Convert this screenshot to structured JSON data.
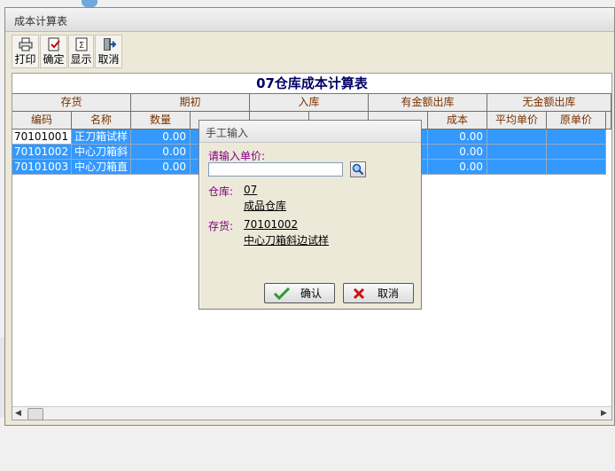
{
  "window": {
    "title": "成本计算表"
  },
  "toolbar": {
    "print": "打印",
    "confirm": "确定",
    "display": "显示",
    "cancel": "取消"
  },
  "report": {
    "title": "07仓库成本计算表",
    "groups": [
      "存货",
      "期初",
      "入库",
      "有金额出库",
      "无金额出库"
    ],
    "columns": {
      "code": "编码",
      "name": "名称",
      "qty": "数量",
      "out_cost": "成本",
      "avg_price": "平均单价",
      "orig_price": "原单价"
    },
    "rows": [
      {
        "code": "70101001",
        "name": "正刀箱试样",
        "qty": "0.00",
        "out_cost": "0.00"
      },
      {
        "code": "70101002",
        "name": "中心刀箱斜",
        "qty": "0.00",
        "out_cost": "0.00"
      },
      {
        "code": "70101003",
        "name": "中心刀箱直",
        "qty": "0.00",
        "out_cost": "0.00"
      }
    ]
  },
  "dialog": {
    "title": "手工输入",
    "prompt": "请输入单价:",
    "input_value": "",
    "warehouse_label": "仓库:",
    "warehouse_code": "07",
    "warehouse_name": "成品仓库",
    "item_label": "存货:",
    "item_code": "70101002",
    "item_name": "中心刀箱斜边试样",
    "ok_label": "确认",
    "cancel_label": "取消"
  },
  "colors": {
    "selection": "#3399ff",
    "header_text": "#7a3200",
    "title_text": "#000066",
    "label_purple": "#800080"
  }
}
